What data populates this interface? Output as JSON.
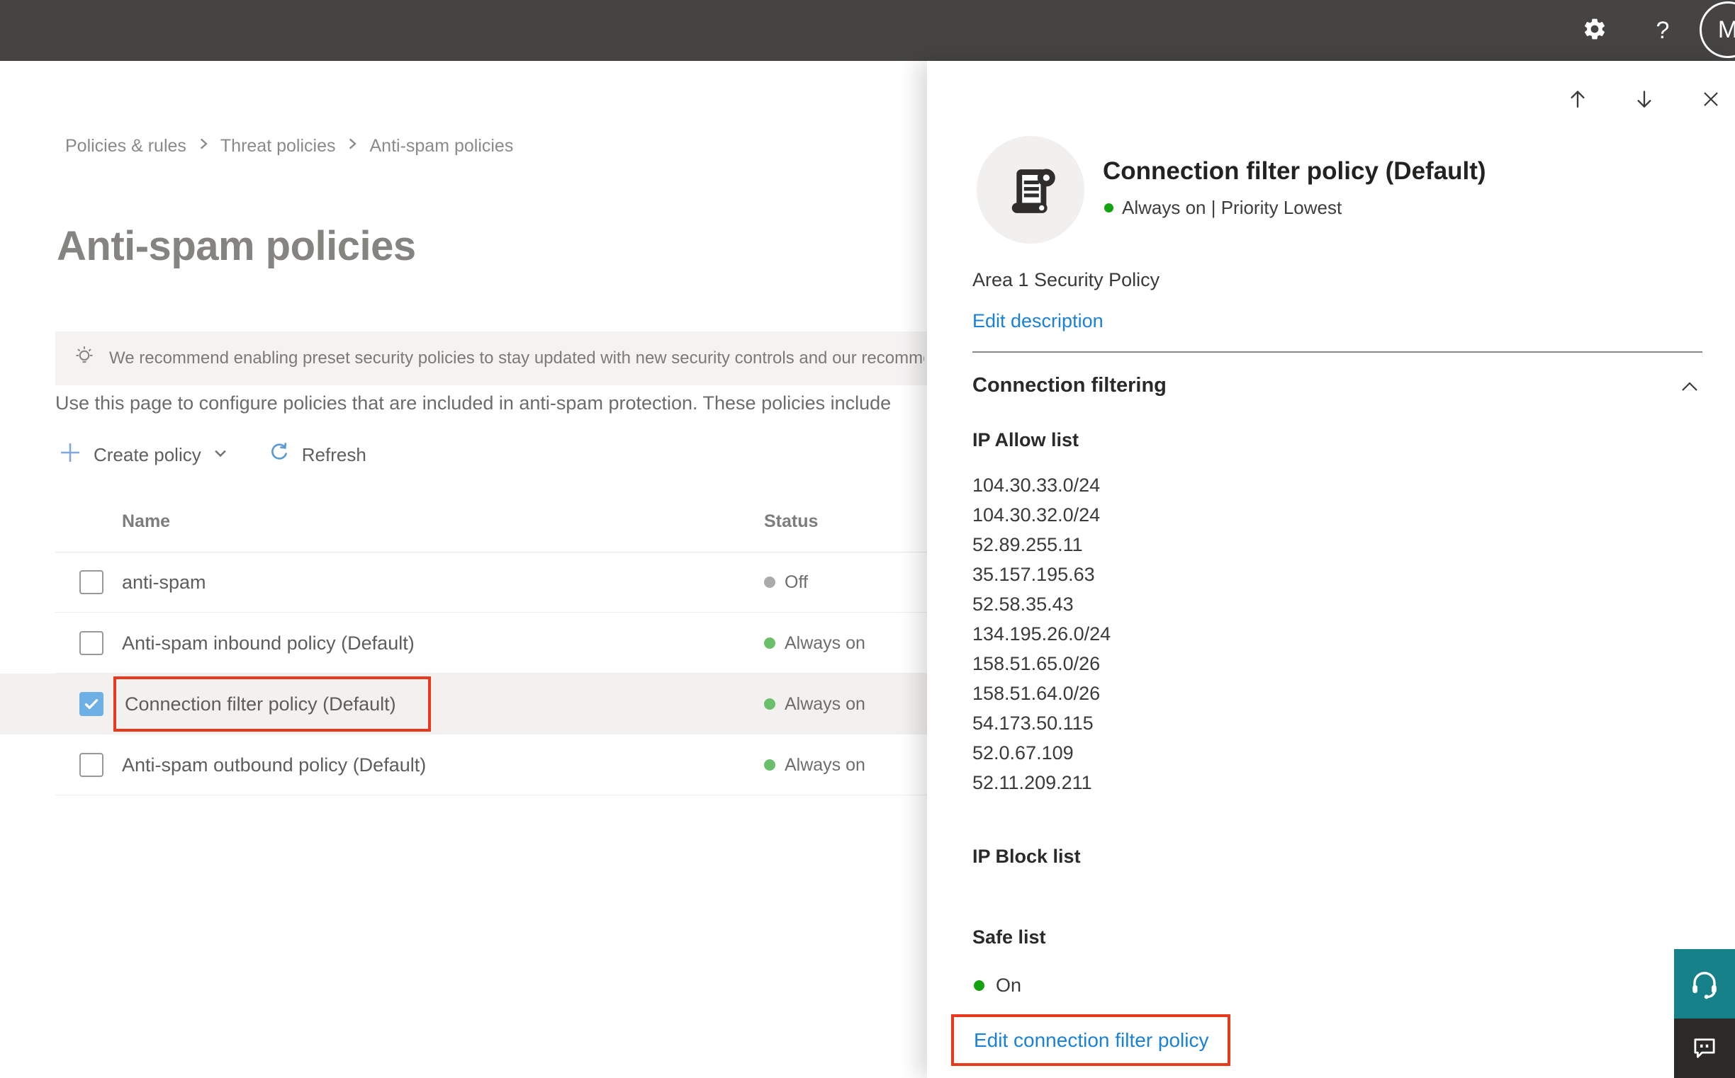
{
  "topbar": {
    "help_label": "?",
    "avatar_initial": "M"
  },
  "breadcrumb": {
    "items": [
      "Policies & rules",
      "Threat policies",
      "Anti-spam policies"
    ]
  },
  "page": {
    "title": "Anti-spam policies",
    "banner_text": "We recommend enabling preset security policies to stay updated with new security controls and our recomme",
    "description": "Use this page to configure policies that are included in anti-spam protection. These policies include"
  },
  "toolbar": {
    "create_label": "Create policy",
    "refresh_label": "Refresh"
  },
  "table": {
    "headers": [
      "Name",
      "Status"
    ],
    "rows": [
      {
        "name": "anti-spam",
        "status": "Off",
        "state": "off",
        "checked": false
      },
      {
        "name": "Anti-spam inbound policy (Default)",
        "status": "Always on",
        "state": "on",
        "checked": false
      },
      {
        "name": "Connection filter policy (Default)",
        "status": "Always on",
        "state": "on",
        "checked": true,
        "highlighted": true
      },
      {
        "name": "Anti-spam outbound policy (Default)",
        "status": "Always on",
        "state": "on",
        "checked": false
      }
    ]
  },
  "panel": {
    "title": "Connection filter policy (Default)",
    "status_line": "Always on | Priority Lowest",
    "description": "Area 1 Security Policy",
    "edit_description_label": "Edit description",
    "section_title": "Connection filtering",
    "ip_allow": {
      "label": "IP Allow list",
      "items": [
        "104.30.33.0/24",
        "104.30.32.0/24",
        "52.89.255.11",
        "35.157.195.63",
        "52.58.35.43",
        "134.195.26.0/24",
        "158.51.65.0/26",
        "158.51.64.0/26",
        "54.173.50.115",
        "52.0.67.109",
        "52.11.209.211"
      ]
    },
    "ip_block": {
      "label": "IP Block list"
    },
    "safe_list": {
      "label": "Safe list",
      "status": "On"
    },
    "edit_link_label": "Edit connection filter policy"
  },
  "colors": {
    "topbar_bg": "#454442",
    "accent_blue_link": "#1a80d8",
    "toolbar_icon_blue": "#5b9bd5",
    "checkbox_blue": "#6cb0e6",
    "status_green": "#6cbf6a",
    "bright_green": "#12a30e",
    "status_gray_off": "#abaaa8",
    "annotation_red": "#e8391d",
    "help_teal": "#17818a",
    "feedback_dark": "#2b2a28"
  }
}
